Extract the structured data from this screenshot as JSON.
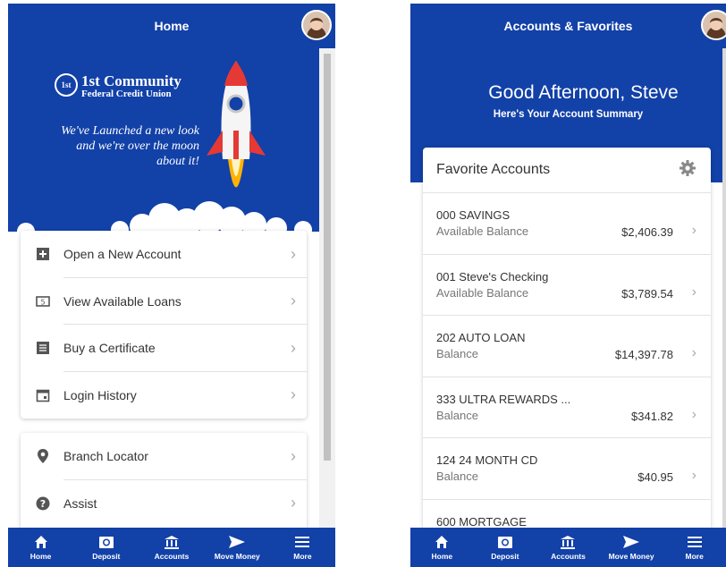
{
  "left": {
    "header": {
      "title": "Home"
    },
    "promo": {
      "logo_mark": "1st",
      "logo_line1": "1st Community",
      "logo_line2": "Federal Credit Union",
      "tagline": "We've Launched a new look and we're over the moon about it!"
    },
    "menu_main": [
      {
        "label": "Open a New Account",
        "icon": "add-box-icon"
      },
      {
        "label": "View Available Loans",
        "icon": "money-icon"
      },
      {
        "label": "Buy a Certificate",
        "icon": "document-icon"
      },
      {
        "label": "Login History",
        "icon": "calendar-icon"
      }
    ],
    "menu_second": [
      {
        "label": "Branch Locator",
        "icon": "location-pin-icon"
      },
      {
        "label": "Assist",
        "icon": "help-icon"
      }
    ]
  },
  "right": {
    "header": {
      "title": "Accounts & Favorites"
    },
    "greeting": "Good Afternoon, Steve",
    "greeting_sub": "Here's Your Account Summary",
    "favorites": {
      "title": "Favorite Accounts",
      "accounts": [
        {
          "name": "000 SAVINGS",
          "label": "Available Balance",
          "amount": "$2,406.39"
        },
        {
          "name": "001 Steve's Checking",
          "label": "Available Balance",
          "amount": "$3,789.54"
        },
        {
          "name": "202 AUTO LOAN",
          "label": "Balance",
          "amount": "$14,397.78"
        },
        {
          "name": "333 ULTRA REWARDS ...",
          "label": "Balance",
          "amount": "$341.82"
        },
        {
          "name": "124 24 MONTH CD",
          "label": "Balance",
          "amount": "$40.95"
        },
        {
          "name": "600 MORTGAGE",
          "label": "",
          "amount": ""
        }
      ]
    }
  },
  "nav": [
    {
      "label": "Home",
      "icon": "home-icon"
    },
    {
      "label": "Deposit",
      "icon": "camera-icon"
    },
    {
      "label": "Accounts",
      "icon": "bank-icon"
    },
    {
      "label": "Move Money",
      "icon": "send-icon"
    },
    {
      "label": "More",
      "icon": "menu-icon"
    }
  ],
  "colors": {
    "brand_blue": "#1241a8",
    "rocket_red": "#e53935",
    "flame": "#ffb300"
  }
}
